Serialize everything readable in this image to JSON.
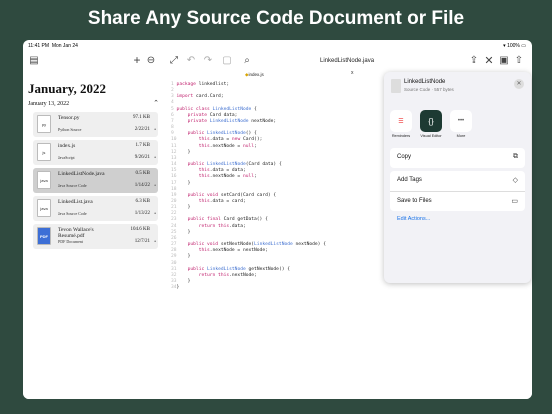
{
  "headline": "Share Any Source Code Document or File",
  "status": {
    "time": "11:41 PM",
    "date": "Mon Jan 24",
    "battery": "100%"
  },
  "sidebar": {
    "month": "January, 2022",
    "day": "January 13, 2022",
    "files": [
      {
        "name": "Tensor.py",
        "type": "Python Source",
        "size": "97.1 KB",
        "date": "2/22/21",
        "icon": "py"
      },
      {
        "name": "index.js",
        "type": "JavaScript",
        "size": "1.7 KB",
        "date": "9/26/21",
        "icon": "js"
      },
      {
        "name": "LinkedListNode.java",
        "type": "Java Source Code",
        "size": "0.5 KB",
        "date": "1/14/22",
        "icon": "java"
      },
      {
        "name": "LinkedList.java",
        "type": "Java Source Code",
        "size": "6.3 KB",
        "date": "1/13/22",
        "icon": "java"
      },
      {
        "name": "Tevon Wallace's Resumé.pdf",
        "type": "PDF Document",
        "size": "104.6 KB",
        "date": "12/7/21",
        "icon": "PDF"
      }
    ]
  },
  "editor": {
    "title": "LinkedListNode.java",
    "tab": "index.js",
    "close": "x"
  },
  "sheet": {
    "file_name": "LinkedListNode",
    "file_sub": "Source Code · 557 bytes",
    "apps": [
      {
        "label": "Reminders"
      },
      {
        "label": "Visual Editor",
        "glyph": "{}"
      },
      {
        "label": "More",
        "glyph": "•••"
      }
    ],
    "actions": [
      {
        "label": "Copy"
      },
      {
        "label": "Add Tags"
      },
      {
        "label": "Save to Files"
      }
    ],
    "edit_actions": "Edit Actions..."
  }
}
